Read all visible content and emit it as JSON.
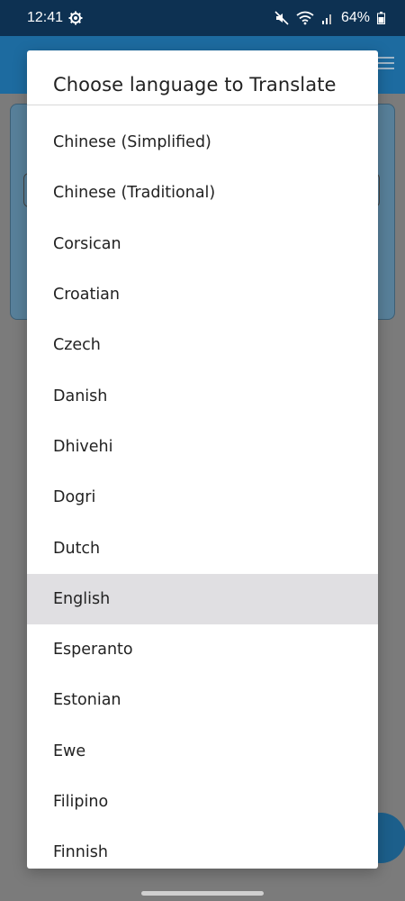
{
  "status_bar": {
    "time": "12:41",
    "battery": "64%"
  },
  "dialog": {
    "title": "Choose language to Translate",
    "languages": [
      "Chinese (Simplified)",
      "Chinese (Traditional)",
      "Corsican",
      "Croatian",
      "Czech",
      "Danish",
      "Dhivehi",
      "Dogri",
      "Dutch",
      "English",
      "Esperanto",
      "Estonian",
      "Ewe",
      "Filipino",
      "Finnish"
    ],
    "selected": "English"
  },
  "icons": {
    "settings": "gear-icon",
    "mute": "mute-icon",
    "wifi": "wifi-icon",
    "signal": "signal-icon",
    "battery": "battery-icon",
    "menu": "hamburger-menu-icon"
  },
  "colors": {
    "status_bar": "#0d3152",
    "app_bar": "#1d6ba0",
    "selected_row": "#e0dfe2"
  }
}
